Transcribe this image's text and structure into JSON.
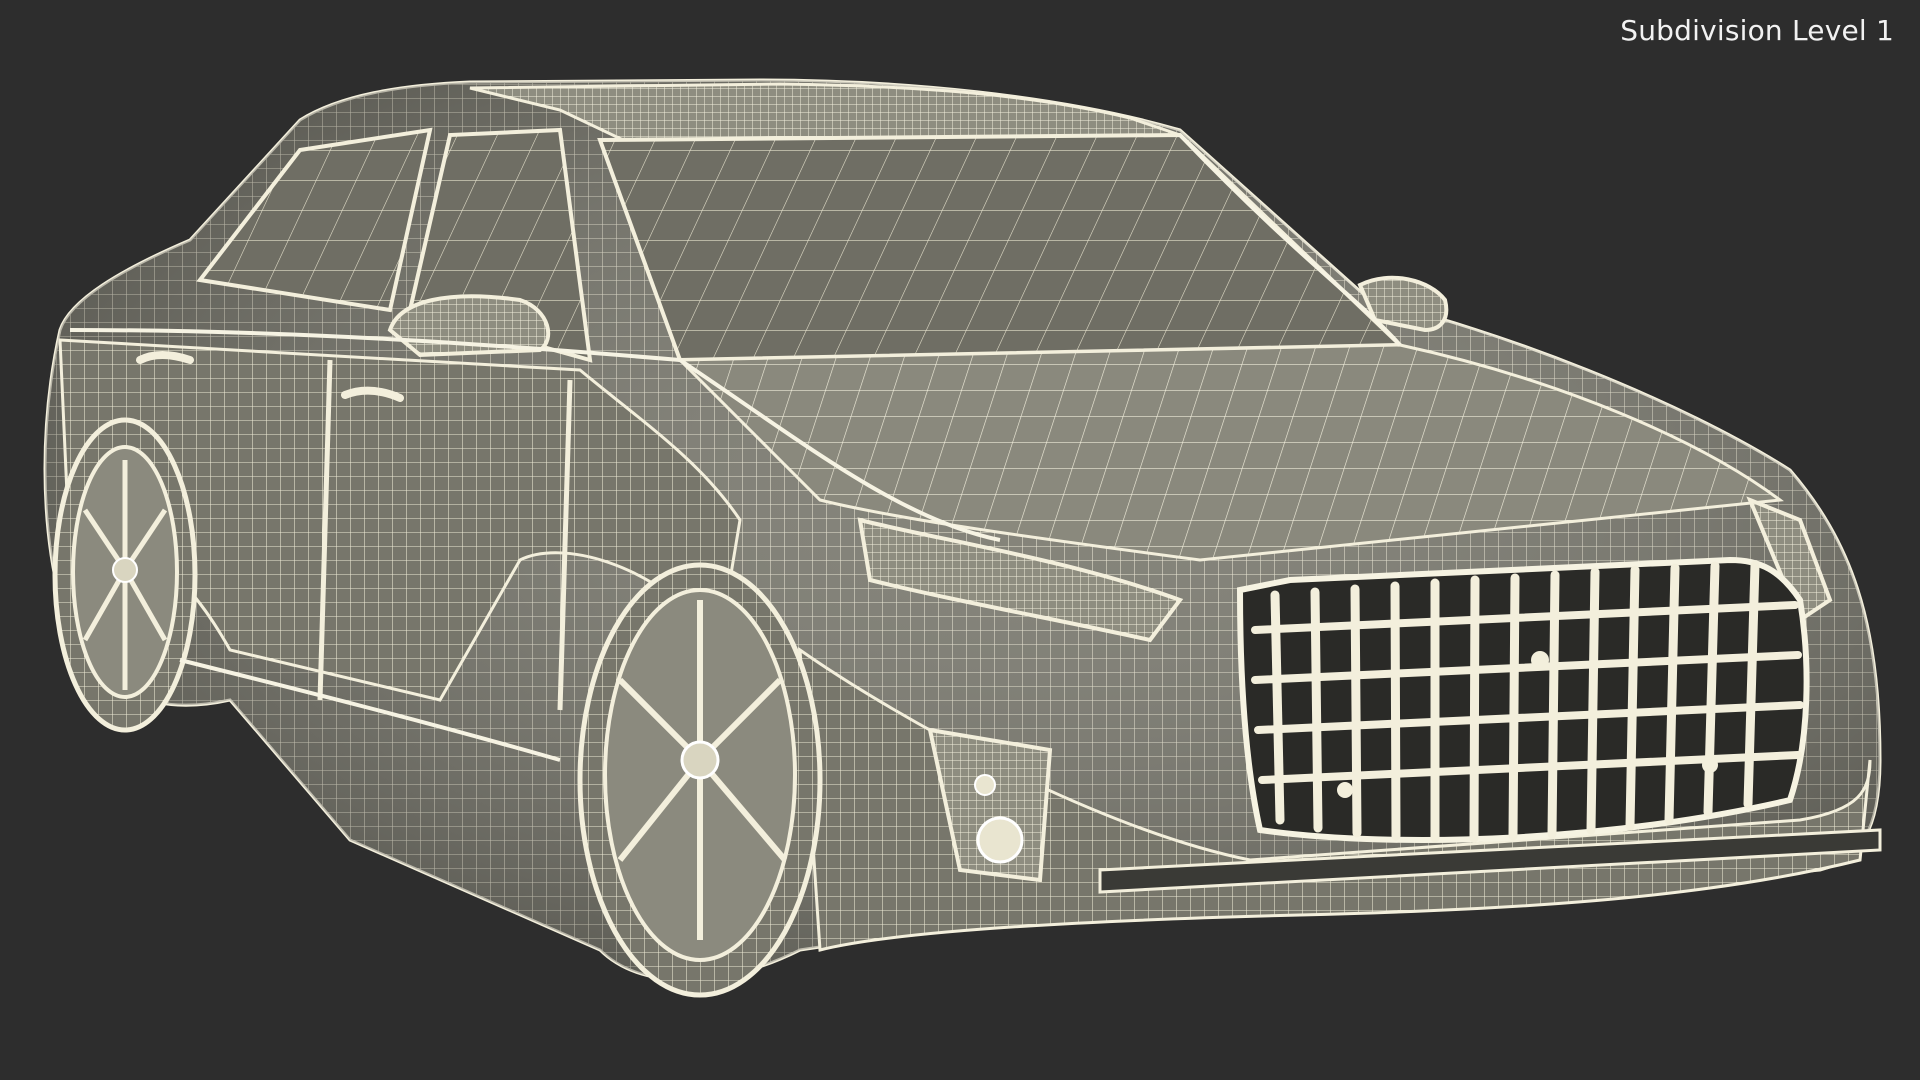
{
  "viewport": {
    "label": "Subdivision Level 1"
  },
  "colors": {
    "background": "#2d2d2d",
    "wire": "#f3efdc",
    "surface": "#7b7a6e",
    "surface_dark": "#4d4c45"
  }
}
